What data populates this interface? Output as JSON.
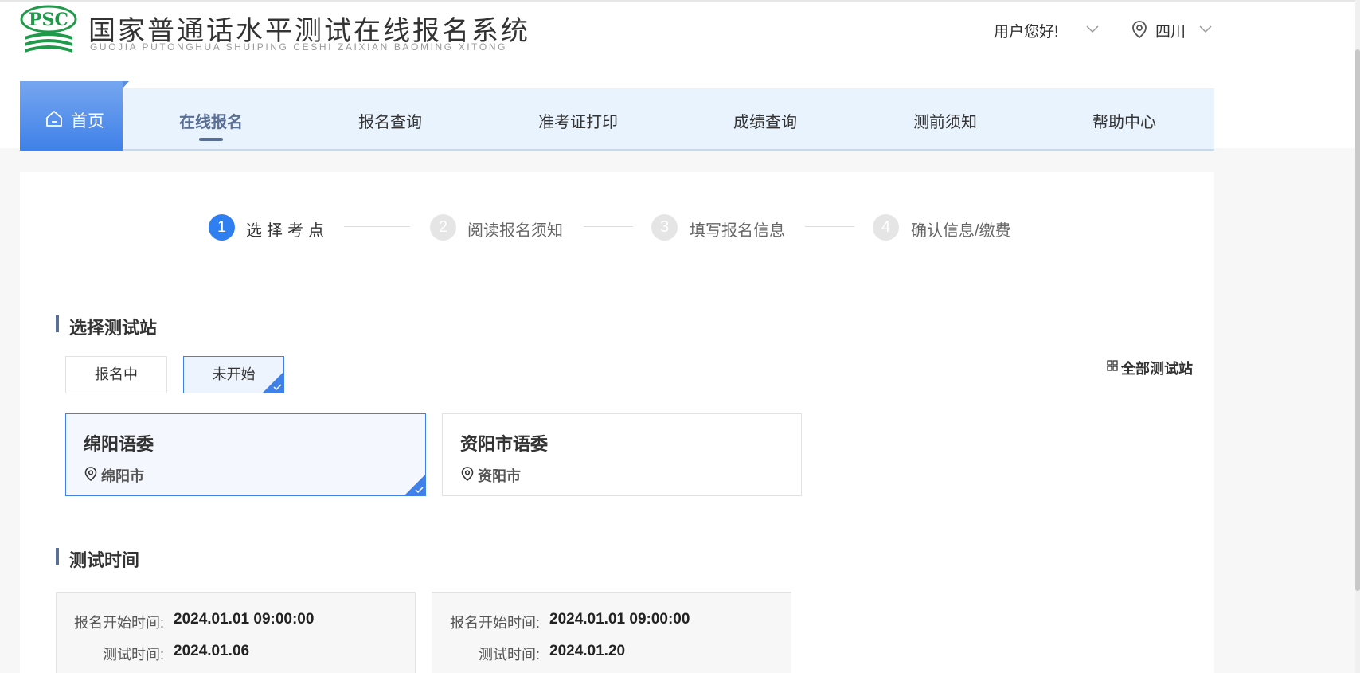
{
  "header": {
    "logo_mark_text": "PSC",
    "title": "国家普通话水平测试在线报名系统",
    "subtitle": "GUOJIA PUTONGHUA SHUIPING CESHI ZAIXIAN BAOMING XITONG",
    "greeting": "用户您好!",
    "location": "四川"
  },
  "nav": {
    "home": "首页",
    "items": [
      "在线报名",
      "报名查询",
      "准考证打印",
      "成绩查询",
      "测前须知",
      "帮助中心"
    ],
    "active": "在线报名"
  },
  "steps": [
    {
      "num": "1",
      "label": "选择考点",
      "state": "active"
    },
    {
      "num": "2",
      "label": "阅读报名须知",
      "state": "todo"
    },
    {
      "num": "3",
      "label": "填写报名信息",
      "state": "todo"
    },
    {
      "num": "4",
      "label": "确认信息/缴费",
      "state": "todo"
    }
  ],
  "station_section": {
    "title": "选择测试站",
    "tabs": [
      "报名中",
      "未开始"
    ],
    "selected_tab": "未开始",
    "all_link": "全部测试站",
    "stations": [
      {
        "name": "绵阳语委",
        "city": "绵阳市",
        "selected": true
      },
      {
        "name": "资阳市语委",
        "city": "资阳市",
        "selected": false
      }
    ]
  },
  "time_section": {
    "title": "测试时间",
    "cards": [
      {
        "start_label": "报名开始时间:",
        "start_value": "2024.01.01 09:00:00",
        "test_label": "测试时间:",
        "test_value": "2024.01.06"
      },
      {
        "start_label": "报名开始时间:",
        "start_value": "2024.01.01 09:00:00",
        "test_label": "测试时间:",
        "test_value": "2024.01.20"
      }
    ]
  },
  "colors": {
    "accent": "#3f81e8",
    "nav_bg": "#e9f3fd",
    "section_bar": "#5a6f95",
    "logo_green": "#1f9a4a"
  }
}
